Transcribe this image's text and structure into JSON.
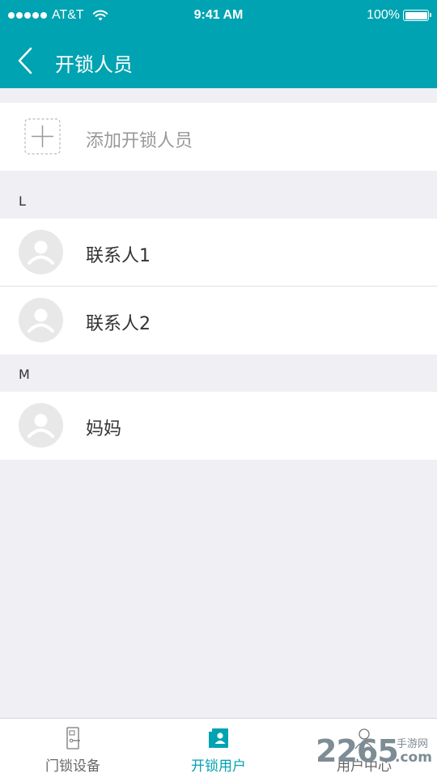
{
  "status_bar": {
    "carrier": "AT&T",
    "time": "9:41 AM",
    "battery": "100%",
    "signal_icon": "signal-dots-icon",
    "wifi_icon": "wifi-icon",
    "battery_icon": "battery-icon"
  },
  "nav": {
    "title": "开锁人员",
    "back_icon": "chevron-left-icon"
  },
  "add_row": {
    "label": "添加开锁人员",
    "icon": "plus-icon"
  },
  "sections": [
    {
      "letter": "L",
      "contacts": [
        {
          "name": "联系人1",
          "avatar_icon": "avatar-placeholder-icon"
        },
        {
          "name": "联系人2",
          "avatar_icon": "avatar-placeholder-icon"
        }
      ]
    },
    {
      "letter": "M",
      "contacts": [
        {
          "name": "妈妈",
          "avatar_icon": "avatar-placeholder-icon"
        }
      ]
    }
  ],
  "tabs": [
    {
      "label": "门锁设备",
      "icon": "door-lock-icon",
      "active": false
    },
    {
      "label": "开锁用户",
      "icon": "contact-card-icon",
      "active": true
    },
    {
      "label": "用户中心",
      "icon": "user-icon",
      "active": false
    }
  ],
  "watermark": {
    "number": "2265",
    "site": "手游网",
    "domain": ".com"
  },
  "colors": {
    "accent": "#00a3b1",
    "background": "#efeff4",
    "text": "#333333",
    "muted": "#999999"
  }
}
